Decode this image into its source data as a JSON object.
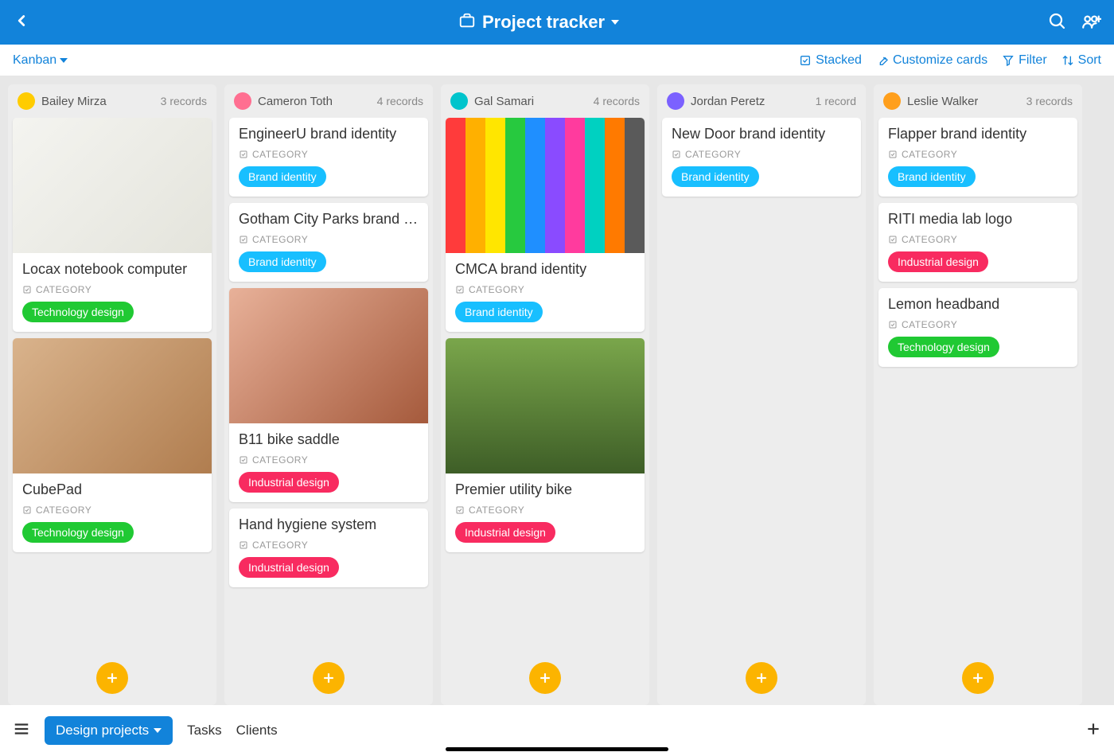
{
  "header": {
    "title": "Project tracker"
  },
  "subbar": {
    "view": "Kanban",
    "stacked": "Stacked",
    "customize": "Customize cards",
    "filter": "Filter",
    "sort": "Sort"
  },
  "labels": {
    "category": "CATEGORY"
  },
  "tag_colors": {
    "Brand identity": "#18bfff",
    "Technology design": "#20c933",
    "Industrial design": "#f82b60"
  },
  "avatar_colors": [
    "#ffcc00",
    "#ff6f91",
    "#00c4cc",
    "#7b61ff",
    "#ff9f1c"
  ],
  "columns": [
    {
      "name": "Bailey Mirza",
      "count": "3 records",
      "cards": [
        {
          "title": "Locax notebook computer",
          "category": "Technology design",
          "has_image": true,
          "image_bg": "linear-gradient(135deg,#f4f4f0,#e4e4dc)"
        },
        {
          "title": "CubePad",
          "category": "Technology design",
          "has_image": true,
          "image_bg": "linear-gradient(135deg,#d9b38c,#b07d4f)"
        }
      ]
    },
    {
      "name": "Cameron Toth",
      "count": "4 records",
      "cards": [
        {
          "title": "EngineerU brand identity",
          "category": "Brand identity",
          "has_image": false
        },
        {
          "title": "Gotham City Parks brand identity",
          "category": "Brand identity",
          "has_image": false
        },
        {
          "title": "B11 bike saddle",
          "category": "Industrial design",
          "has_image": true,
          "image_bg": "linear-gradient(135deg,#e8b199,#a55a3c)"
        },
        {
          "title": "Hand hygiene system",
          "category": "Industrial design",
          "has_image": false
        }
      ]
    },
    {
      "name": "Gal Samari",
      "count": "4 records",
      "cards": [
        {
          "title": "CMCA brand identity",
          "category": "Brand identity",
          "has_image": true,
          "image_bg": "linear-gradient(90deg,#ff3b3b 0 10%,#ffb000 10% 20%,#ffe600 20% 30%,#27c93f 30% 40%,#1f8fff 40% 50%,#8a4bff 50% 60%,#ff3b9e 60% 70%,#00d1c1 70% 80%,#ff7a00 80% 90%,#5a5a5a 90% 100%)"
        },
        {
          "title": "Premier utility bike",
          "category": "Industrial design",
          "has_image": true,
          "image_bg": "linear-gradient(180deg,#7aa64b,#3e5e27)"
        }
      ]
    },
    {
      "name": "Jordan Peretz",
      "count": "1 record",
      "cards": [
        {
          "title": "New Door brand identity",
          "category": "Brand identity",
          "has_image": false
        }
      ]
    },
    {
      "name": "Leslie Walker",
      "count": "3 records",
      "cards": [
        {
          "title": "Flapper brand identity",
          "category": "Brand identity",
          "has_image": false
        },
        {
          "title": "RITI media lab logo",
          "category": "Industrial design",
          "has_image": false
        },
        {
          "title": "Lemon headband",
          "category": "Technology design",
          "has_image": false
        }
      ]
    }
  ],
  "bottom": {
    "active_tab": "Design projects",
    "tabs": [
      "Tasks",
      "Clients"
    ]
  }
}
